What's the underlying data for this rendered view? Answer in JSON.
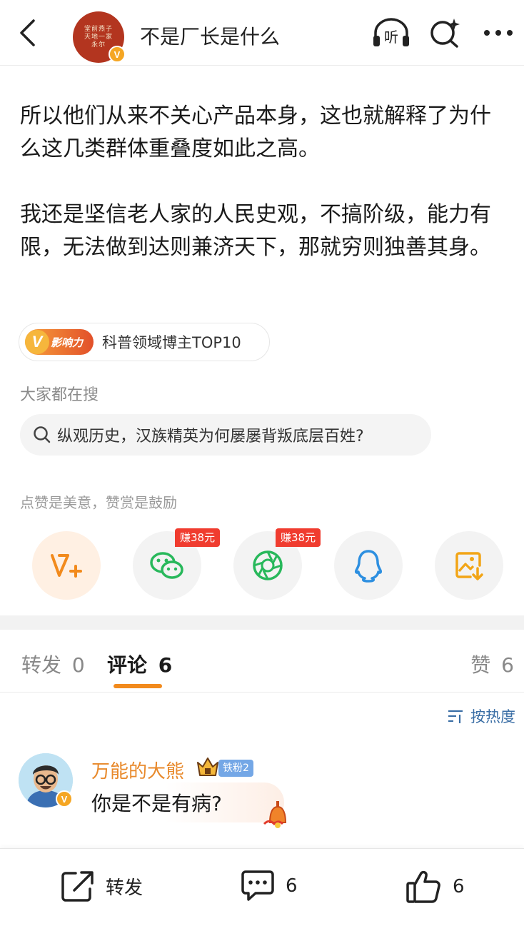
{
  "header": {
    "author_name": "不是厂长是什么",
    "avatar_seal_text": "堂前燕子天地一家永尔",
    "verified_badge": "V",
    "icons": [
      "back-arrow-icon",
      "listen-icon",
      "search-sparkle-icon",
      "more-icon"
    ],
    "listen_label": "听"
  },
  "post": {
    "paragraphs": [
      "所以他们从来不关心产品本身，这也就解释了为什么这几类群体重叠度如此之高。",
      "我还是坚信老人家的人民史观，不搞阶级，能力有限，无法做到达则兼济天下，那就穷则独善其身。"
    ]
  },
  "influence": {
    "badge_v": "V",
    "badge_text": "影响力",
    "label": "科普领域博主TOP10"
  },
  "hot_search": {
    "title": "大家都在搜",
    "query": "纵观历史，汉族精英为何屡屡背叛底层百姓?"
  },
  "reward_area": {
    "caption": "点赞是美意，赞赏是鼓励",
    "share_buttons": [
      {
        "name": "v-plus",
        "icon": "v-plus-icon",
        "badge": ""
      },
      {
        "name": "wechat",
        "icon": "wechat-icon",
        "badge": "赚38元"
      },
      {
        "name": "moments",
        "icon": "moments-icon",
        "badge": "赚38元"
      },
      {
        "name": "qq",
        "icon": "qq-icon",
        "badge": ""
      },
      {
        "name": "save-image",
        "icon": "save-image-icon",
        "badge": ""
      }
    ]
  },
  "tabs": {
    "repost": "转发",
    "repost_count": "0",
    "comment": "评论",
    "comment_count": "6",
    "like": "赞",
    "like_count": "6"
  },
  "sort": {
    "label": "按热度"
  },
  "comments": [
    {
      "user": "万能的大熊",
      "fan_badge": "铁粉2",
      "text": "你是不是有病?",
      "verified_badge": "V"
    }
  ],
  "bottom_bar": {
    "repost_label": "转发",
    "comment_count": "6",
    "like_count": "6"
  },
  "colors": {
    "accent_orange": "#f28a1c",
    "reward_red": "#f03c2f",
    "link_blue": "#3a6ea5",
    "username_orange": "#e8892b"
  }
}
